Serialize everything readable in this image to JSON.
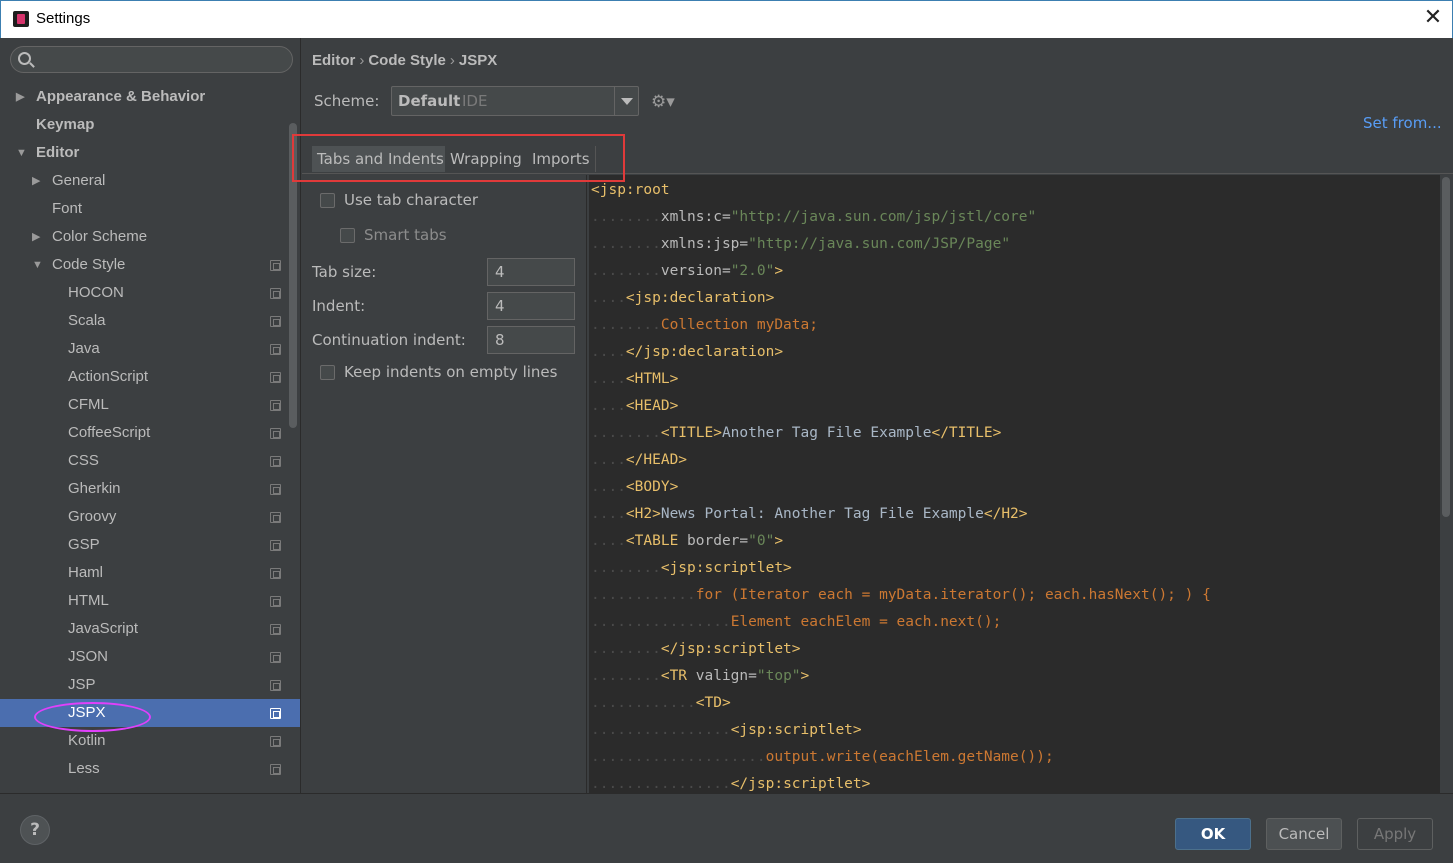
{
  "window": {
    "title": "Settings"
  },
  "search": {
    "placeholder": ""
  },
  "sidebar": {
    "items": [
      {
        "label": "Appearance & Behavior",
        "bold": true,
        "arrow": "▶"
      },
      {
        "label": "Keymap",
        "bold": true,
        "arrow": ""
      },
      {
        "label": "Editor",
        "bold": true,
        "arrow": "▼"
      },
      {
        "label": "General",
        "bold": false,
        "arrow": "▶"
      },
      {
        "label": "Font",
        "bold": false,
        "arrow": ""
      },
      {
        "label": "Color Scheme",
        "bold": false,
        "arrow": "▶"
      },
      {
        "label": "Code Style",
        "bold": false,
        "arrow": "▼"
      },
      {
        "label": "HOCON"
      },
      {
        "label": "Scala"
      },
      {
        "label": "Java"
      },
      {
        "label": "ActionScript"
      },
      {
        "label": "CFML"
      },
      {
        "label": "CoffeeScript"
      },
      {
        "label": "CSS"
      },
      {
        "label": "Gherkin"
      },
      {
        "label": "Groovy"
      },
      {
        "label": "GSP"
      },
      {
        "label": "Haml"
      },
      {
        "label": "HTML"
      },
      {
        "label": "JavaScript"
      },
      {
        "label": "JSON"
      },
      {
        "label": "JSP"
      },
      {
        "label": "JSPX",
        "selected": true
      },
      {
        "label": "Kotlin"
      },
      {
        "label": "Less"
      }
    ]
  },
  "breadcrumb": {
    "part1": "Editor",
    "part2": "Code Style",
    "part3": "JSPX",
    "sep": "›"
  },
  "scheme": {
    "label": "Scheme:",
    "value": "Default",
    "sub": "IDE"
  },
  "set_from": "Set from...",
  "tabs": [
    {
      "label": "Tabs and Indents",
      "active": true
    },
    {
      "label": "Wrapping",
      "active": false
    },
    {
      "label": "Imports",
      "active": false
    }
  ],
  "options": {
    "use_tab": "Use tab character",
    "smart_tabs": "Smart tabs",
    "tab_size_label": "Tab size:",
    "tab_size": "4",
    "indent_label": "Indent:",
    "indent": "4",
    "cont_label": "Continuation indent:",
    "cont": "8",
    "keep_indents": "Keep indents on empty lines"
  },
  "code_lines": [
    [
      [
        "tg",
        "<jsp:root"
      ]
    ],
    [
      [
        "dots",
        "........"
      ],
      [
        "at",
        "xmlns:c="
      ],
      [
        "st",
        "\"http://java.sun.com/jsp/jstl/core\""
      ]
    ],
    [
      [
        "dots",
        "........"
      ],
      [
        "at",
        "xmlns:jsp="
      ],
      [
        "st",
        "\"http://java.sun.com/JSP/Page\""
      ]
    ],
    [
      [
        "dots",
        "........"
      ],
      [
        "at",
        "version="
      ],
      [
        "st",
        "\"2.0\""
      ],
      [
        "tg",
        ">"
      ]
    ],
    [
      [
        "dots",
        "...."
      ],
      [
        "tg",
        "<jsp:declaration>"
      ]
    ],
    [
      [
        "dots",
        "........"
      ],
      [
        "jv",
        "Collection myData;"
      ]
    ],
    [
      [
        "dots",
        "...."
      ],
      [
        "tg",
        "</jsp:declaration>"
      ]
    ],
    [
      [
        "dots",
        "...."
      ],
      [
        "tg",
        "<HTML>"
      ]
    ],
    [
      [
        "dots",
        "...."
      ],
      [
        "tg",
        "<HEAD>"
      ]
    ],
    [
      [
        "dots",
        "........"
      ],
      [
        "tg",
        "<TITLE>"
      ],
      [
        "tx",
        "Another Tag File Example"
      ],
      [
        "tg",
        "</TITLE>"
      ]
    ],
    [
      [
        "dots",
        "...."
      ],
      [
        "tg",
        "</HEAD>"
      ]
    ],
    [
      [
        "dots",
        "...."
      ],
      [
        "tg",
        "<BODY>"
      ]
    ],
    [
      [
        "dots",
        "...."
      ],
      [
        "tg",
        "<H2>"
      ],
      [
        "tx",
        "News Portal: Another Tag File Example"
      ],
      [
        "tg",
        "</H2>"
      ]
    ],
    [
      [
        "dots",
        "...."
      ],
      [
        "tg",
        "<TABLE "
      ],
      [
        "at",
        "border="
      ],
      [
        "st",
        "\"0\""
      ],
      [
        "tg",
        ">"
      ]
    ],
    [
      [
        "dots",
        "........"
      ],
      [
        "tg",
        "<jsp:scriptlet>"
      ]
    ],
    [
      [
        "dots",
        "............"
      ],
      [
        "jv",
        "for (Iterator each = myData.iterator(); each.hasNext(); ) {"
      ]
    ],
    [
      [
        "dots",
        "................"
      ],
      [
        "jv",
        "Element eachElem = each.next();"
      ]
    ],
    [
      [
        "dots",
        "........"
      ],
      [
        "tg",
        "</jsp:scriptlet>"
      ]
    ],
    [
      [
        "dots",
        "........"
      ],
      [
        "tg",
        "<TR "
      ],
      [
        "at",
        "valign="
      ],
      [
        "st",
        "\"top\""
      ],
      [
        "tg",
        ">"
      ]
    ],
    [
      [
        "dots",
        "............"
      ],
      [
        "tg",
        "<TD>"
      ]
    ],
    [
      [
        "dots",
        "................"
      ],
      [
        "tg",
        "<jsp:scriptlet>"
      ]
    ],
    [
      [
        "dots",
        "...................."
      ],
      [
        "jv",
        "output.write(eachElem.getName());"
      ]
    ],
    [
      [
        "dots",
        "................"
      ],
      [
        "tg",
        "</jsp:scriptlet>"
      ]
    ]
  ],
  "buttons": {
    "help": "?",
    "ok": "OK",
    "cancel": "Cancel",
    "apply": "Apply"
  },
  "colors": {
    "accent": "#4b6eaf",
    "link": "#589df6",
    "highlight_red": "#e03a3a",
    "highlight_magenta": "#e040fb"
  }
}
